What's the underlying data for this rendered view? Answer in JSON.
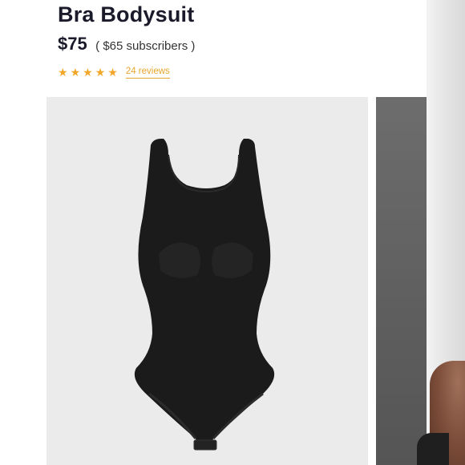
{
  "product": {
    "title": "Bra Bodysuit",
    "price": "$75",
    "subscriber_price": "( $65 subscribers )",
    "rating": 5,
    "reviews_label": "24 reviews"
  },
  "colors": {
    "accent": "#f2a628",
    "garment": "#1b1b1b",
    "image_bg": "#ebebeb"
  },
  "icons": {
    "star": "star-icon"
  }
}
